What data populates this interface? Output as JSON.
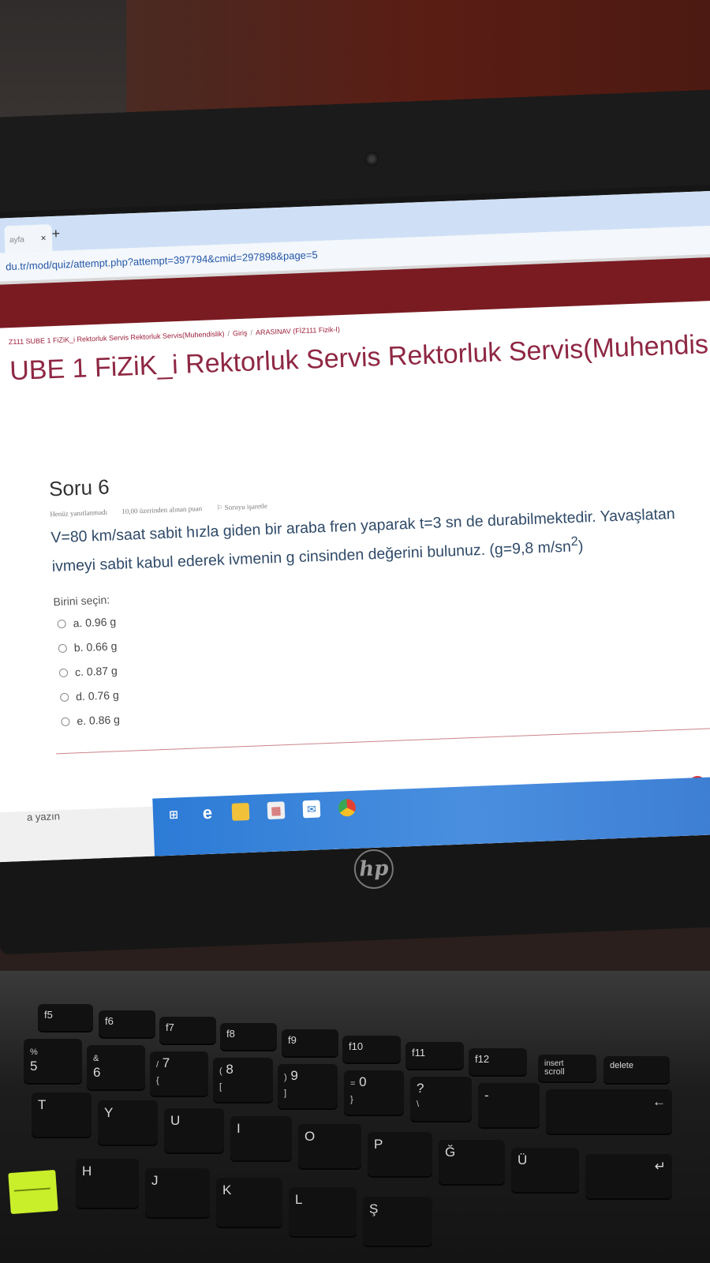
{
  "browser": {
    "tab_label": "ayfa",
    "tab_close": "×",
    "new_tab": "+",
    "url": "du.tr/mod/quiz/attempt.php?attempt=397794&cmid=297898&page=5"
  },
  "breadcrumb": [
    "Z111 SUBE 1 FiZiK_i Rektorluk Servis Rektorluk Servis(Muhendislik)",
    "Giriş",
    "ARASINAV (FİZ111 Fizik-I)"
  ],
  "course_title": "UBE 1 FiZiK_i Rektorluk Servis Rektorluk Servis(Muhendis",
  "question": {
    "title": "Soru 6",
    "status": "Henüz yanıtlanmadı",
    "points": "10,00 üzerinden alınan puan",
    "flag": "Soruyu işaretle",
    "text_line1": "V=80 km/saat sabit hızla giden bir araba fren yaparak t=3 sn de durabilmektedir. Yavaşlatan",
    "text_line2_a": "ivmeyi sabit kabul ederek ivmenin g cinsinden değerini bulunuz. (g=9,8 m/sn",
    "text_line2_sup": "2",
    "text_line2_b": ")",
    "prompt": "Birini seçin:",
    "options": [
      "a. 0.96 g",
      "b. 0.66 g",
      "c. 0.87 g",
      "d. 0.76 g",
      "e. 0.86 g"
    ]
  },
  "taskbar": {
    "search_text": "a yazın"
  },
  "laptop": {
    "brand": "hp"
  },
  "keyboard": {
    "f5": "f5",
    "f6": "f6",
    "f7": "f7",
    "f8": "f8",
    "f9": "f9",
    "f10": "f10",
    "f11": "f11",
    "f12": "f12",
    "insert": "insert",
    "scroll": "scroll",
    "delete": "delete",
    "percent": "%",
    "five": "5",
    "amp": "&",
    "six": "6",
    "slash": "/",
    "seven": "7",
    "lbrace": "{",
    "lparen": "(",
    "eight": "8",
    "lbracket": "[",
    "rparen": ")",
    "nine": "9",
    "rbracket": "]",
    "equals": "=",
    "zero": "0",
    "rbrace": "}",
    "question": "?",
    "backslash": "\\",
    "dash": "-",
    "T": "T",
    "Y": "Y",
    "U": "U",
    "I": "I",
    "O": "O",
    "P": "P",
    "G_breve": "Ğ",
    "U_uml": "Ü",
    "H": "H",
    "J": "J",
    "K": "K",
    "L": "L",
    "S_cedil": "Ş"
  }
}
